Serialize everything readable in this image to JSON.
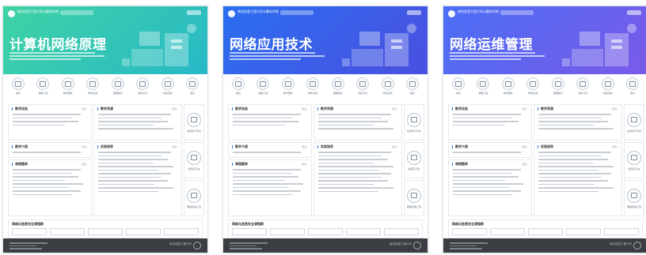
{
  "panels": [
    {
      "school_name": "南京信息工程大学计算机学院",
      "title": "计算机网络原理",
      "hero_colors": [
        "#3fd3a4",
        "#28b8c7"
      ],
      "icons": [
        {
          "icon": "home-icon",
          "label": "首页"
        },
        {
          "icon": "intro-icon",
          "label": "课程介绍"
        },
        {
          "icon": "team-icon",
          "label": "教学团队"
        },
        {
          "icon": "resource-icon",
          "label": "教学资源"
        },
        {
          "icon": "book-icon",
          "label": "课程教材"
        },
        {
          "icon": "exam-icon",
          "label": "考核方式"
        },
        {
          "icon": "practice-icon",
          "label": "实验实践"
        },
        {
          "icon": "more-icon",
          "label": "更多"
        }
      ],
      "cards": [
        {
          "title": "教学动态",
          "more": "更多>"
        },
        {
          "title": "教学资源",
          "more": "更多>"
        },
        {
          "title": "教学大纲",
          "more": "更多>"
        },
        {
          "title": "实验指导",
          "more": "更多>"
        },
        {
          "title": "课程题库",
          "more": "更多>"
        }
      ],
      "side": [
        {
          "icon": "video-icon",
          "label": "在线学习平台"
        },
        {
          "icon": "cloud-icon",
          "label": "资源云平台"
        },
        {
          "icon": "tools-icon",
          "label": "网络实验工具"
        }
      ],
      "links_title": "网络与信息安全课程群"
    },
    {
      "school_name": "南京信息工程大学计算机学院",
      "title": "网络应用技术",
      "hero_colors": [
        "#2a6ff0",
        "#4b4fe0"
      ],
      "icons": [
        {
          "icon": "home-icon",
          "label": "首页"
        },
        {
          "icon": "intro-icon",
          "label": "课程介绍"
        },
        {
          "icon": "team-icon",
          "label": "教学团队"
        },
        {
          "icon": "resource-icon",
          "label": "教学资源"
        },
        {
          "icon": "book-icon",
          "label": "课程教材"
        },
        {
          "icon": "exam-icon",
          "label": "考核方式"
        },
        {
          "icon": "practice-icon",
          "label": "实验实践"
        },
        {
          "icon": "more-icon",
          "label": "更多"
        }
      ],
      "cards": [
        {
          "title": "教学动态",
          "more": "更多>"
        },
        {
          "title": "教学资源",
          "more": "更多>"
        },
        {
          "title": "教学大纲",
          "more": "更多>"
        },
        {
          "title": "实验指导",
          "more": "更多>"
        },
        {
          "title": "课程题库",
          "more": "更多>"
        }
      ],
      "side": [
        {
          "icon": "video-icon",
          "label": "在线学习平台"
        },
        {
          "icon": "cloud-icon",
          "label": "资源云平台"
        },
        {
          "icon": "tools-icon",
          "label": "网络实验工具"
        }
      ],
      "links_title": "网络与信息安全课程群"
    },
    {
      "school_name": "南京信息工程大学计算机学院",
      "title": "网络运维管理",
      "hero_colors": [
        "#4a6ef5",
        "#7a5ae8"
      ],
      "icons": [
        {
          "icon": "home-icon",
          "label": "首页"
        },
        {
          "icon": "intro-icon",
          "label": "课程介绍"
        },
        {
          "icon": "team-icon",
          "label": "教学团队"
        },
        {
          "icon": "resource-icon",
          "label": "教学资源"
        },
        {
          "icon": "book-icon",
          "label": "课程教材"
        },
        {
          "icon": "exam-icon",
          "label": "考核方式"
        },
        {
          "icon": "practice-icon",
          "label": "实验实践"
        },
        {
          "icon": "more-icon",
          "label": "更多"
        }
      ],
      "cards": [
        {
          "title": "教学动态",
          "more": "更多>"
        },
        {
          "title": "教学资源",
          "more": "更多>"
        },
        {
          "title": "教学大纲",
          "more": "更多>"
        },
        {
          "title": "实验指导",
          "more": "更多>"
        },
        {
          "title": "课程题库",
          "more": "更多>"
        }
      ],
      "side": [
        {
          "icon": "video-icon",
          "label": "在线学习平台"
        },
        {
          "icon": "cloud-icon",
          "label": "资源云平台"
        },
        {
          "icon": "tools-icon",
          "label": "网络实验工具"
        }
      ],
      "links_title": "网络与信息安全课程群"
    }
  ],
  "footer_school": "南京信息工程大学"
}
